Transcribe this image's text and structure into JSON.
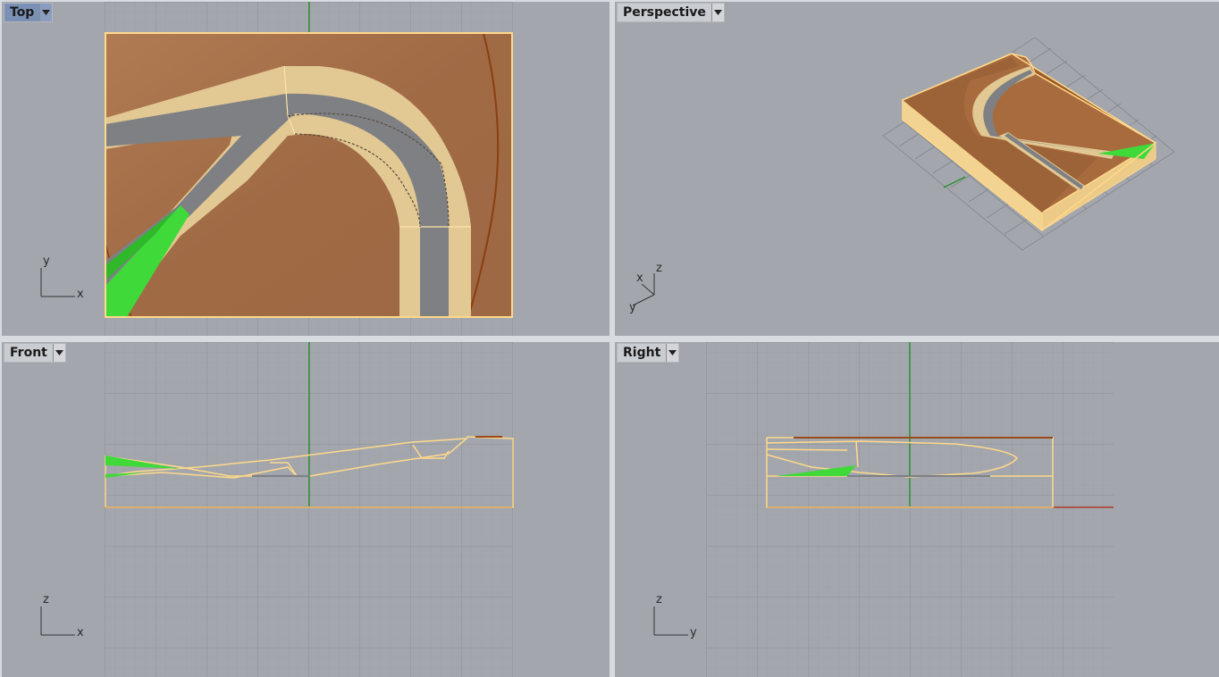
{
  "viewports": {
    "top": {
      "title": "Top",
      "active": true
    },
    "perspective": {
      "title": "Perspective",
      "active": false
    },
    "front": {
      "title": "Front",
      "active": false
    },
    "right": {
      "title": "Right",
      "active": false
    }
  },
  "axis_labels": {
    "top": {
      "horizontal": "x",
      "vertical": "y"
    },
    "perspective": {
      "x": "x",
      "y": "y",
      "z": "z"
    },
    "front": {
      "horizontal": "x",
      "vertical": "z"
    },
    "right": {
      "horizontal": "y",
      "vertical": "z"
    }
  },
  "colors": {
    "viewport_bg": "#a3a7ad",
    "grid_minor": "#9a9ea5",
    "grid_major": "#80858c",
    "axis_green": "#2f8f2f",
    "axis_red": "#b03a2a",
    "selection": "#ffd88a",
    "terrain": "#a8704a",
    "road": "#7e8084",
    "shoulder": "#e2c893",
    "grass": "#3fd93a",
    "active_tab": "#7a90b4"
  },
  "icons": {
    "viewport_menu": "dropdown-arrow-icon"
  }
}
